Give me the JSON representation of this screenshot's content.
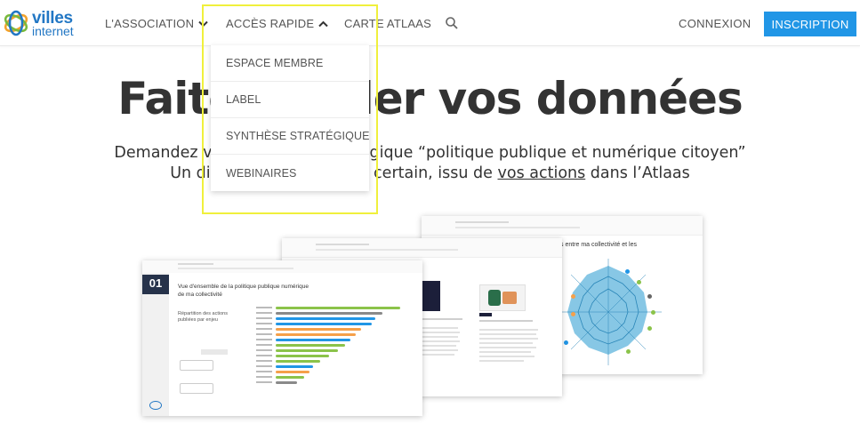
{
  "logo": {
    "line1": "villes",
    "line2": "internet"
  },
  "nav": {
    "association": "L'ASSOCIATION",
    "acces_rapide": "ACCÈS RAPIDE",
    "carte_atlaas": "CARTE ATLAAS",
    "connexion": "CONNEXION",
    "inscription": "INSCRIPTION"
  },
  "dropdown": {
    "items": [
      "ESPACE MEMBRE",
      "LABEL",
      "SYNTHÈSE STRATÉGIQUE",
      "WEBINAIRES"
    ]
  },
  "hero": {
    "title": "Faites parler vos données",
    "sub1_pre": "Demandez votre synthèse stratégique ",
    "sub1_bold": "",
    "sub1_post": "“politique publique et numérique citoyen”",
    "sub2_pre": "Un diagnostic sur-mesure certain, issu de ",
    "sub2_link": "vos actions",
    "sub2_post": " dans l’Atlaas"
  },
  "preview": {
    "p1_number": "01",
    "p1_title_1": "Vue d'ensemble de la politique publique numérique",
    "p1_title_2": "de ma collectivité",
    "p1_left_1": "Répartition des actions",
    "p1_left_2": "publiées par enjeu",
    "p3_title": "s entre ma collectivité et les"
  },
  "colors": {
    "brand_blue": "#2277c4",
    "inscription_bg": "#2196e6",
    "highlight": "#f0f03c",
    "bar_green": "#8bc34a",
    "bar_blue": "#2196e6",
    "bar_orange": "#f5a04a",
    "bar_gray": "#8a8a8a"
  }
}
